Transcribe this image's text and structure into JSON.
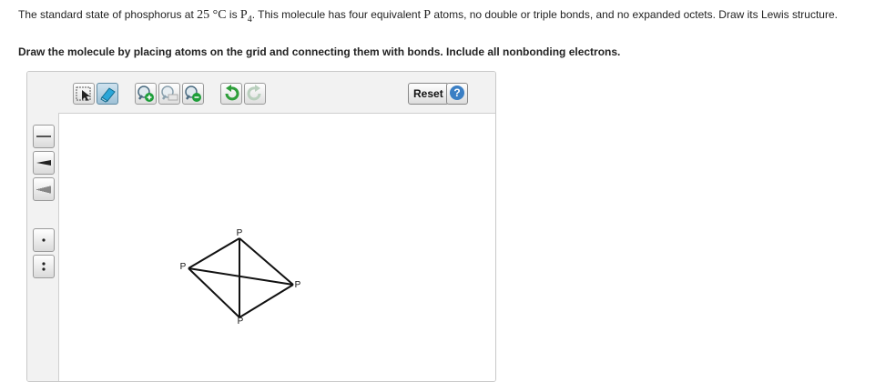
{
  "question": {
    "text_a": "The standard state of phosphorus at ",
    "temp_num": "25",
    "temp_unit": " °C",
    "text_b": " is ",
    "formula_symbol": "P",
    "formula_sub": "4",
    "text_c": ". This molecule has four equivalent ",
    "atom_symbol": "P",
    "text_d": " atoms, no double or triple bonds, and no expanded octets. Draw its Lewis structure."
  },
  "instruction": "Draw the molecule by placing atoms on the grid and connecting them with bonds. Include all nonbonding electrons.",
  "toolbar": {
    "reset_label": "Reset",
    "help_label": "?",
    "tools": [
      "select-icon",
      "eraser-icon",
      "zoom-in-icon",
      "zoom-reset-icon",
      "zoom-out-icon",
      "undo-icon",
      "redo-icon"
    ]
  },
  "sidebar": {
    "tools": [
      "single-bond-icon",
      "wedge-bond-icon",
      "hashed-bond-icon",
      "lone-electron-icon",
      "lone-pair-icon"
    ]
  },
  "molecule": {
    "atoms": [
      {
        "id": "top",
        "label": "P"
      },
      {
        "id": "left",
        "label": "P"
      },
      {
        "id": "right",
        "label": "P"
      },
      {
        "id": "bottom",
        "label": "P"
      }
    ],
    "bonds": [
      [
        "top",
        "left"
      ],
      [
        "top",
        "right"
      ],
      [
        "top",
        "bottom"
      ],
      [
        "left",
        "right"
      ],
      [
        "left",
        "bottom"
      ],
      [
        "right",
        "bottom"
      ]
    ]
  },
  "colors": {
    "accent": "#3b7fc4",
    "toolbar_bg": "#f2f2f2",
    "eraser": "#2aa6d8",
    "zoom_in": "#1e9e3a",
    "zoom_out": "#1e9e3a",
    "undo": "#2e9e3a"
  }
}
